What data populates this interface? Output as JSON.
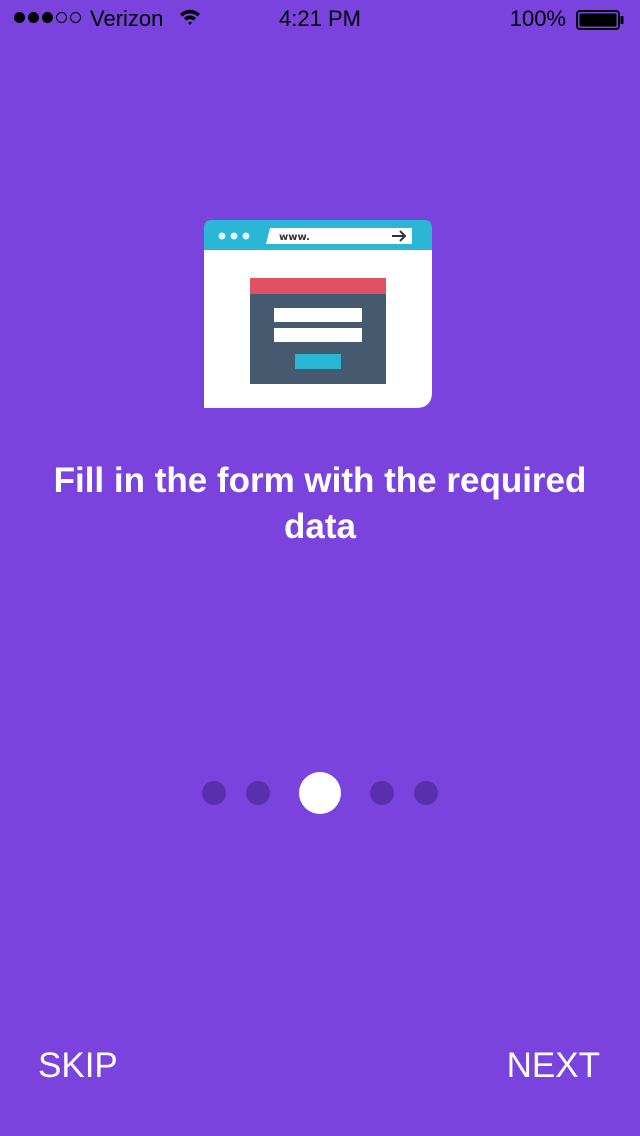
{
  "theme": {
    "background": "#7b43dd",
    "dot_inactive": "#5a2fae",
    "dot_active": "#ffffff"
  },
  "status_bar": {
    "signal_bars_filled": 3,
    "signal_bars_total": 5,
    "carrier": "Verizon",
    "time": "4:21 PM",
    "battery": "100%"
  },
  "illustration": {
    "address_text": "www.",
    "icon": "web-form-illustration"
  },
  "onboarding": {
    "heading": "Fill in the form with the required data",
    "page_count": 5,
    "current_page": 3
  },
  "actions": {
    "skip_label": "SKIP",
    "next_label": "NEXT"
  }
}
